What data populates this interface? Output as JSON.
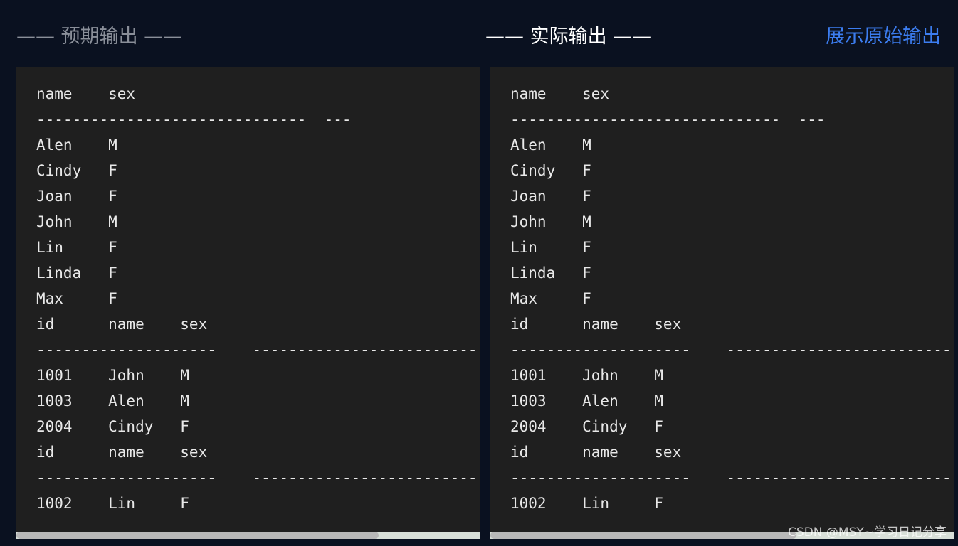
{
  "headings": {
    "expected": "—— 预期输出 ——",
    "actual": "—— 实际输出 ——",
    "show_raw": "展示原始输出"
  },
  "expected_output": [
    "name    sex",
    "------------------------------  ---",
    "Alen    M",
    "Cindy   F",
    "Joan    F",
    "John    M",
    "Lin     F",
    "Linda   F",
    "Max     F",
    "id      name    sex",
    "--------------------    ------------------------------  ---",
    "1001    John    M",
    "1003    Alen    M",
    "2004    Cindy   F",
    "id      name    sex",
    "--------------------    ------------------------------  ---",
    "1002    Lin     F"
  ],
  "actual_output": [
    "name    sex",
    "------------------------------  ---",
    "Alen    M",
    "Cindy   F",
    "Joan    F",
    "John    M",
    "Lin     F",
    "Linda   F",
    "Max     F",
    "id      name    sex",
    "--------------------    ------------------------------  ---",
    "1001    John    M",
    "1003    Alen    M",
    "2004    Cindy   F",
    "id      name    sex",
    "--------------------    ------------------------------  ---",
    "1002    Lin     F"
  ],
  "scroll": {
    "left_thumb_fraction": 0.78,
    "right_thumb_fraction": 0.66
  },
  "watermark": "CSDN @MSY~学习日记分享",
  "colors": {
    "background": "#0a1120",
    "panel": "#1f1f1f",
    "link": "#3c7df0"
  }
}
